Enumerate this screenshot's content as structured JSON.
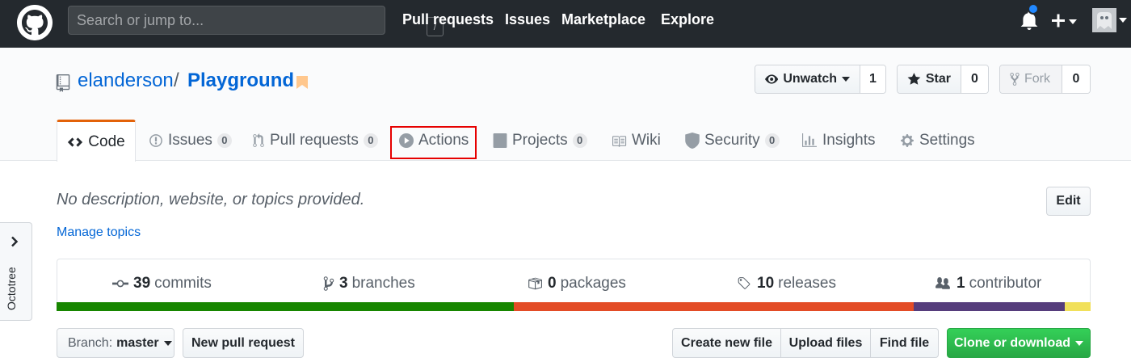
{
  "header": {
    "search_placeholder": "Search or jump to...",
    "search_shortcut": "/",
    "nav": [
      "Pull requests",
      "Issues",
      "Marketplace",
      "Explore"
    ],
    "notification_color": "#2188ff"
  },
  "repo": {
    "owner": "elanderson",
    "separator": "/",
    "name": "Playground",
    "watch": {
      "label": "Unwatch",
      "count": "1"
    },
    "star": {
      "label": "Star",
      "count": "0"
    },
    "fork": {
      "label": "Fork",
      "count": "0"
    }
  },
  "tabs": [
    {
      "label": "Code",
      "icon": "code-icon",
      "counter": ""
    },
    {
      "label": "Issues",
      "icon": "issue-opened-icon",
      "counter": "0"
    },
    {
      "label": "Pull requests",
      "icon": "git-pull-request-icon",
      "counter": "0"
    },
    {
      "label": "Actions",
      "icon": "play-icon",
      "counter": ""
    },
    {
      "label": "Projects",
      "icon": "project-icon",
      "counter": "0"
    },
    {
      "label": "Wiki",
      "icon": "book-icon",
      "counter": ""
    },
    {
      "label": "Security",
      "icon": "shield-icon",
      "counter": "0"
    },
    {
      "label": "Insights",
      "icon": "graph-icon",
      "counter": ""
    },
    {
      "label": "Settings",
      "icon": "gear-icon",
      "counter": ""
    }
  ],
  "selected_tab": "Code",
  "highlighted_tab": "Actions",
  "highlight_color": "#e60000",
  "body": {
    "description": "No description, website, or topics provided.",
    "edit_label": "Edit",
    "manage_topics": "Manage topics"
  },
  "octotree": {
    "label": "Octotree"
  },
  "summary": {
    "commits": {
      "count": "39",
      "label": "commits"
    },
    "branches": {
      "count": "3",
      "label": "branches"
    },
    "packages": {
      "count": "0",
      "label": "packages"
    },
    "releases": {
      "count": "10",
      "label": "releases"
    },
    "contributors": {
      "count": "1",
      "label": "contributor"
    }
  },
  "languages": [
    {
      "color": "#178600",
      "share": 0.442
    },
    {
      "color": "#e34c26",
      "share": 0.387
    },
    {
      "color": "#563d7c",
      "share": 0.146
    },
    {
      "color": "#f1e05a",
      "share": 0.025
    }
  ],
  "file_nav": {
    "branch_prefix": "Branch:",
    "branch": "master",
    "new_pull_request": "New pull request",
    "create_new_file": "Create new file",
    "upload_files": "Upload files",
    "find_file": "Find file",
    "clone_or_download": "Clone or download"
  }
}
